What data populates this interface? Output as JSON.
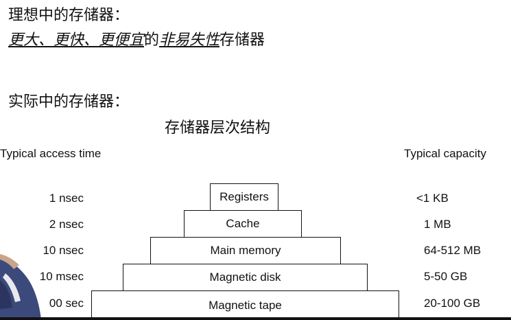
{
  "slide": {
    "ideal_title": "理想中的存储器：",
    "ideal_desc": {
      "part1": "更大、更快、更便宜",
      "part2": "的",
      "part3": "非易失性",
      "part4": "存储器"
    },
    "actual_title": "实际中的存储器：",
    "hierarchy_title": "存储器层次结构",
    "col_time_header": "Typical access time",
    "col_capacity_header": "Typical capacity",
    "levels": [
      {
        "time": "1 nsec",
        "name": "Registers",
        "capacity": "<1 KB"
      },
      {
        "time": "2 nsec",
        "name": "Cache",
        "capacity": "1 MB"
      },
      {
        "time": "10 nsec",
        "name": "Main memory",
        "capacity": "64-512 MB"
      },
      {
        "time": "10 msec",
        "name": "Magnetic disk",
        "capacity": "5-50 GB"
      },
      {
        "time": "00 sec",
        "name": "Magnetic tape",
        "capacity": "20-100 GB"
      }
    ]
  }
}
